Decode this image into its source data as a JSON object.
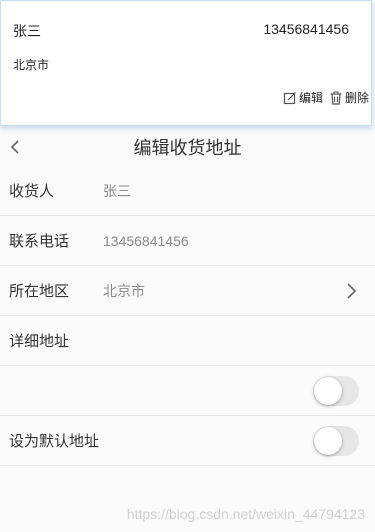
{
  "card": {
    "name": "张三",
    "phone": "13456841456",
    "address": "北京市",
    "edit_label": "编辑",
    "delete_label": "删除"
  },
  "header": {
    "title": "编辑收货地址",
    "back_icon": "chevron-left-icon"
  },
  "form": {
    "receiver": {
      "label": "收货人",
      "value": "张三"
    },
    "phone": {
      "label": "联系电话",
      "value": "13456841456"
    },
    "region": {
      "label": "所在地区",
      "value": "北京市"
    },
    "detail": {
      "label": "详细地址",
      "value": ""
    },
    "unnamed_toggle": {
      "on": false
    },
    "default": {
      "label": "设为默认地址",
      "on": false
    }
  },
  "watermark": "https://blog.csdn.net/weixin_44794123"
}
